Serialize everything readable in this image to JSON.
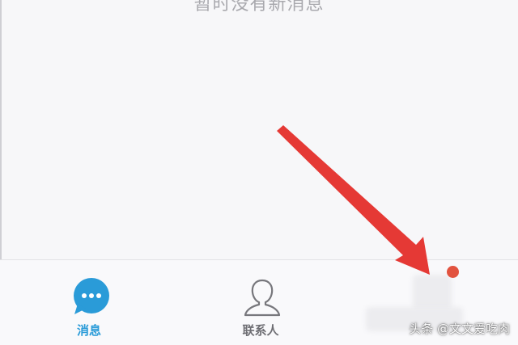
{
  "main": {
    "empty_message": "暂时没有新消息"
  },
  "tabbar": {
    "tabs": [
      {
        "label": "消息",
        "icon": "chat-bubble-icon",
        "active": true
      },
      {
        "label": "联系人",
        "icon": "person-icon",
        "active": false
      },
      {
        "label": "",
        "icon": "dynamic-icon",
        "active": false
      }
    ]
  },
  "overlay": {
    "watermark": "头条 @文文爱吃肉",
    "arrow_color": "#e53935"
  },
  "colors": {
    "accent": "#2a9bd8",
    "badge": "#e2533f",
    "background": "#f7f7f9"
  }
}
